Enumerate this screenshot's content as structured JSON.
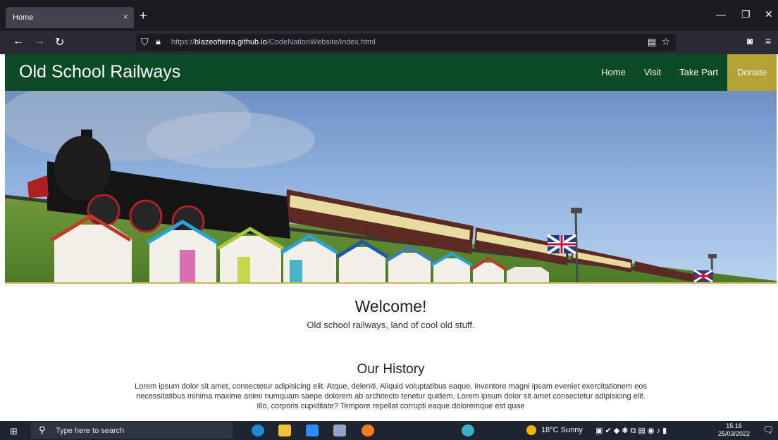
{
  "browser": {
    "tab_title": "Home",
    "tab_close": "×",
    "new_tab": "+",
    "url_prefix": "https://",
    "url_host": "blazeofterra.github.io",
    "url_path": "/CodeNationWebsite/index.html"
  },
  "site": {
    "title": "Old School Railways",
    "nav": [
      "Home",
      "Visit",
      "Take Part",
      "Donate"
    ],
    "welcome_title": "Welcome!",
    "welcome_subtitle": "Old school railways, land of cool old stuff.",
    "history_title": "Our History",
    "history_text": "Lorem ipsum dolor sit amet, consectetur adipisicing elit. Atque, deleniti. Aliquid voluptatibus eaque, inventore magni ipsam eveniet exercitationem eos necessitatibus minima maxime animi numquam saepe dolorem ab architecto tenetur quidem. Lorem ipsum dolor sit amet consectetur adipisicing elit. Illo, corporis cupiditate? Tempore repellat corrupti eaque doloremque est quae",
    "header_color": "#0a4a25",
    "donate_color": "#b5a235"
  },
  "taskbar": {
    "search_placeholder": "Type here to search",
    "weather": "18°C  Sunny",
    "time": "15:16",
    "date": "25/03/2022"
  }
}
